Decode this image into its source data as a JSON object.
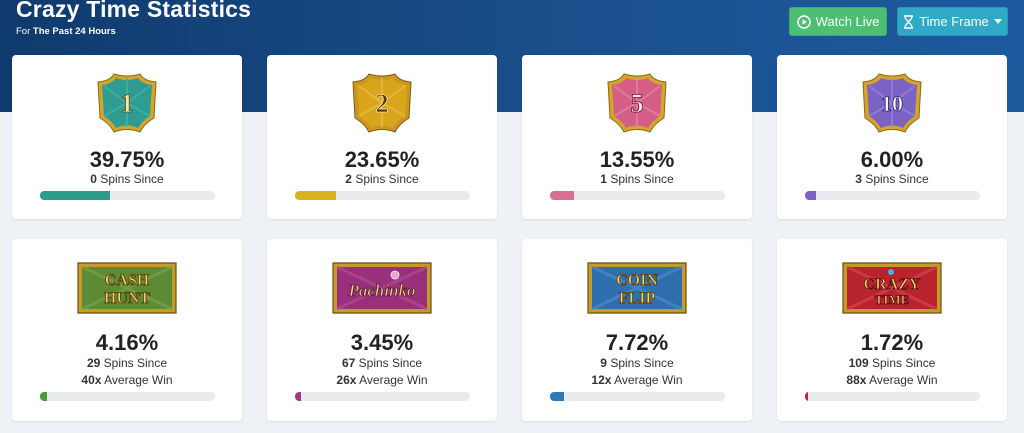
{
  "header": {
    "title": "Crazy Time Statistics",
    "subtitle_prefix": "For",
    "subtitle_period": "The Past 24 Hours",
    "watch_live_label": "Watch Live",
    "time_frame_label": "Time Frame"
  },
  "colors": {
    "watch_live": "#4cbf73",
    "time_frame": "#31a8c6"
  },
  "cards": [
    {
      "badge": "1",
      "percent": "39.75%",
      "percent_value": 39.75,
      "spins": "0",
      "spins_label": "Spins Since",
      "bar_color": "#2b9b8a"
    },
    {
      "badge": "2",
      "percent": "23.65%",
      "percent_value": 23.65,
      "spins": "2",
      "spins_label": "Spins Since",
      "bar_color": "#d9b21f"
    },
    {
      "badge": "5",
      "percent": "13.55%",
      "percent_value": 13.55,
      "spins": "1",
      "spins_label": "Spins Since",
      "bar_color": "#d97091"
    },
    {
      "badge": "10",
      "percent": "6.00%",
      "percent_value": 6.0,
      "spins": "3",
      "spins_label": "Spins Since",
      "bar_color": "#7d62c4"
    },
    {
      "badge": "CASH HUNT",
      "percent": "4.16%",
      "percent_value": 4.16,
      "spins": "29",
      "spins_label": "Spins Since",
      "avg": "40x",
      "avg_label": "Average Win",
      "bar_color": "#4a9b3a"
    },
    {
      "badge": "Pachinko",
      "percent": "3.45%",
      "percent_value": 3.45,
      "spins": "67",
      "spins_label": "Spins Since",
      "avg": "26x",
      "avg_label": "Average Win",
      "bar_color": "#9c3a86"
    },
    {
      "badge": "COIN FLIP",
      "percent": "7.72%",
      "percent_value": 7.72,
      "spins": "9",
      "spins_label": "Spins Since",
      "avg": "12x",
      "avg_label": "Average Win",
      "bar_color": "#2f78b8"
    },
    {
      "badge": "CRAZY TIME",
      "percent": "1.72%",
      "percent_value": 1.72,
      "spins": "109",
      "spins_label": "Spins Since",
      "avg": "88x",
      "avg_label": "Average Win",
      "bar_color": "#c8232d"
    }
  ]
}
